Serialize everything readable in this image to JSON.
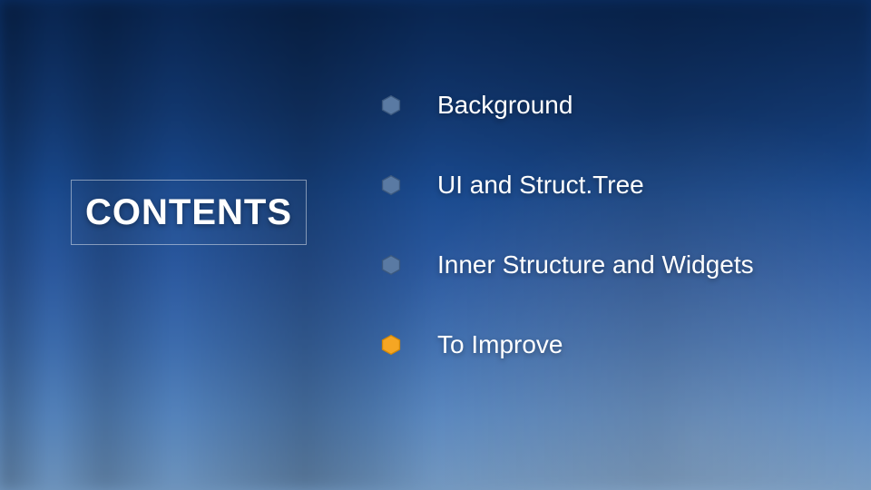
{
  "heading": "CONTENTS",
  "colors": {
    "bullet_default_fill": "#5a7aa3",
    "bullet_default_stroke": "#3c597e",
    "bullet_highlight_fill": "#f5a623",
    "bullet_highlight_stroke": "#d48806"
  },
  "items": [
    {
      "label": "Background",
      "highlight": false
    },
    {
      "label": "UI and Struct.Tree",
      "highlight": false
    },
    {
      "label": "Inner Structure and Widgets",
      "highlight": false
    },
    {
      "label": "To Improve",
      "highlight": true
    }
  ]
}
